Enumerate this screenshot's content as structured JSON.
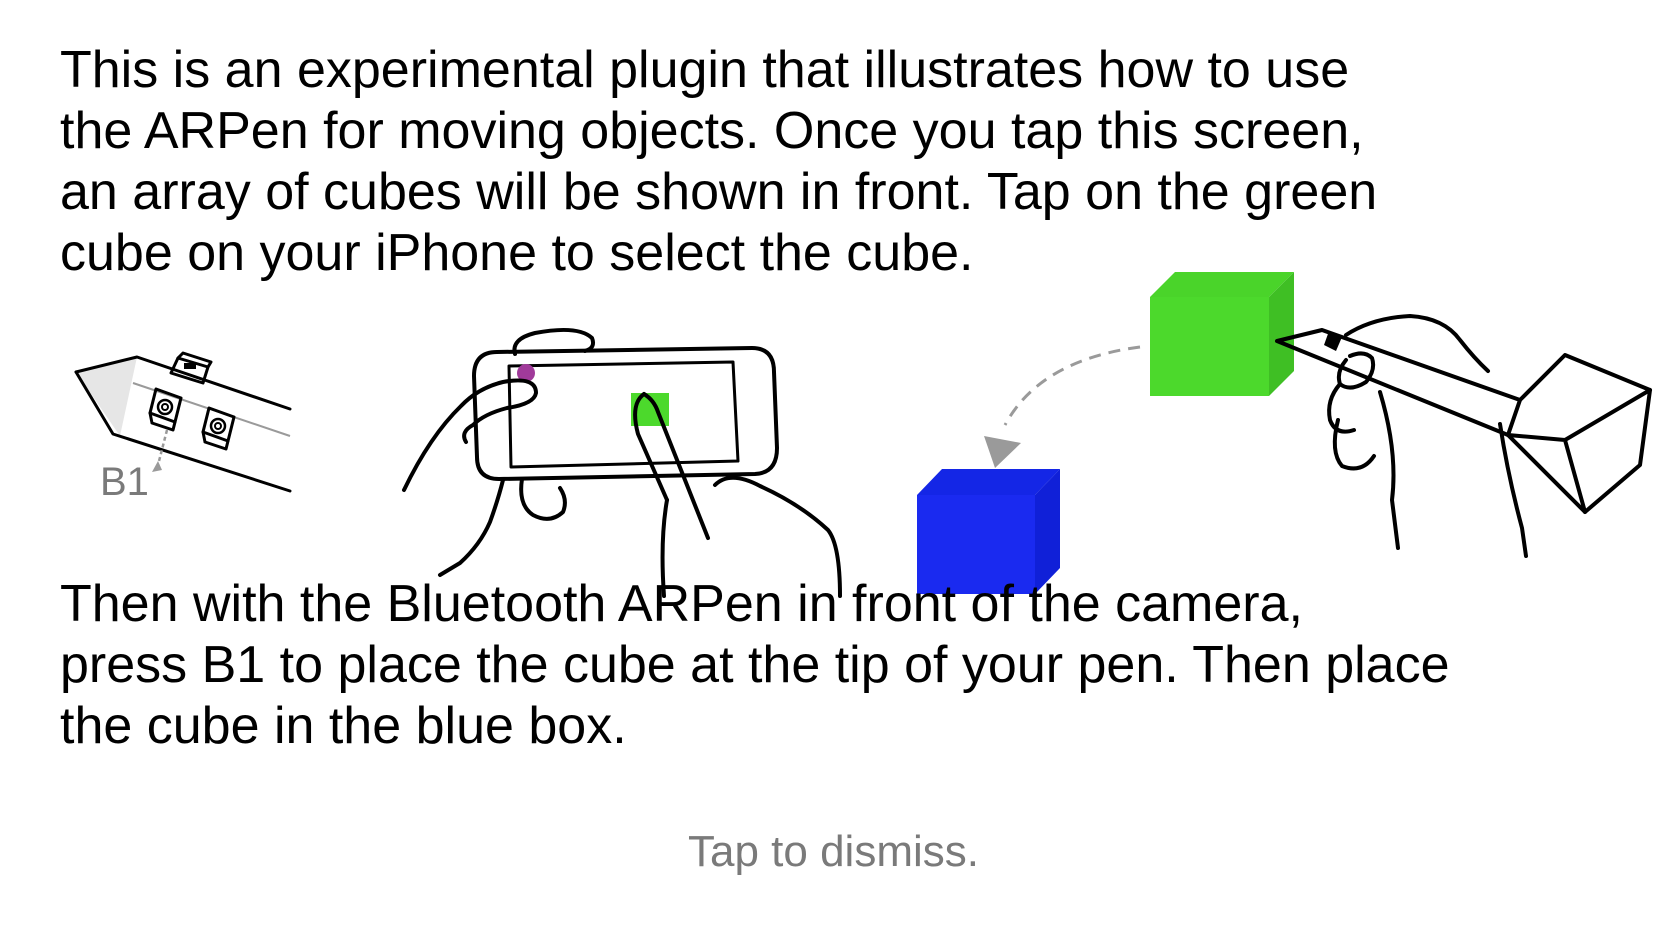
{
  "instructions": {
    "intro_lines": [
      "This is an experimental plugin that illustrates how to use",
      "the ARPen for moving objects. Once you tap this screen,",
      "an array of cubes will be shown in front. Tap on the green",
      "cube on your iPhone to select the cube."
    ],
    "outro_lines": [
      "Then with the Bluetooth ARPen in front of the camera,",
      "press B1 to place the cube at the tip of your pen. Then place",
      "the cube in the blue box."
    ],
    "dismiss_hint": "Tap to dismiss."
  },
  "illustration": {
    "pen_button_label": "B1",
    "colors": {
      "green_cube": "#4cd92c",
      "green_cube_top": "#4ad42a",
      "green_cube_side": "#3fbf24",
      "blue_cube": "#1a2af0",
      "blue_cube_top": "#1426e6",
      "blue_cube_side": "#1020d8",
      "touch_marker": "#a03a9a",
      "arrow_gray": "#9a9a9a"
    }
  }
}
